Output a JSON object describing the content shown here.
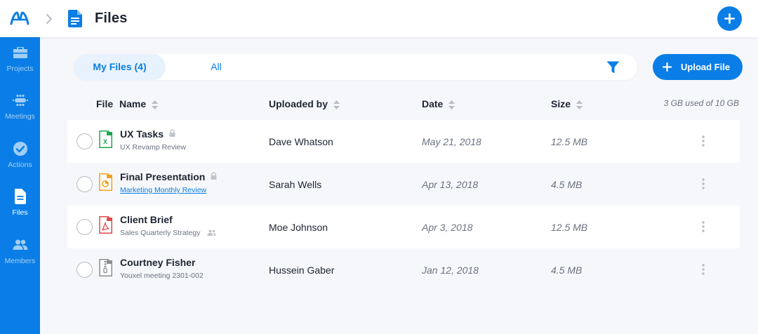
{
  "header": {
    "title": "Files",
    "logo_icon": "app-logo-icon",
    "breadcrumb_icon": "chevron-right-icon",
    "page_icon": "document-icon",
    "add_icon": "plus-icon"
  },
  "colors": {
    "accent": "#0a7ee6",
    "sidebar": "#0a7ee6",
    "text": "#1d2431",
    "muted": "#6b7280",
    "excel": "#1aa84f",
    "slides": "#f0a020",
    "pdf": "#e04a4a",
    "archive": "#8a8f96"
  },
  "sidebar": {
    "items": [
      {
        "label": "Projects",
        "icon": "briefcase-icon"
      },
      {
        "label": "Meetings",
        "icon": "meeting-table-icon"
      },
      {
        "label": "Actions",
        "icon": "check-circle-icon"
      },
      {
        "label": "Files",
        "icon": "document-icon",
        "active": true
      },
      {
        "label": "Members",
        "icon": "people-icon"
      }
    ]
  },
  "toolbar": {
    "tab_my_files": "My Files (4)",
    "tab_all": "All",
    "filter_icon": "filter-funnel-icon",
    "upload_label": "Upload File"
  },
  "table": {
    "columns": {
      "file": "File",
      "name": "Name",
      "uploaded_by": "Uploaded by",
      "date": "Date",
      "size": "Size"
    },
    "storage_note": "3 GB used of 10 GB",
    "rows": [
      {
        "name": "UX Tasks",
        "locked": true,
        "subtitle": "UX Revamp Review",
        "subtitle_link": false,
        "uploader": "Dave Whatson",
        "date": "May 21, 2018",
        "size": "12.5 MB",
        "type": "xls"
      },
      {
        "name": "Final Presentation",
        "locked": true,
        "subtitle": "Marketing Monthly Review",
        "subtitle_link": true,
        "uploader": "Sarah Wells",
        "date": "Apr 13, 2018",
        "size": "4.5 MB",
        "type": "ppt"
      },
      {
        "name": "Client Brief",
        "locked": false,
        "subtitle": "Sales Quarterly Strategy",
        "subtitle_link": false,
        "shared": true,
        "uploader": "Moe Johnson",
        "date": "Apr 3, 2018",
        "size": "12.5 MB",
        "type": "pdf"
      },
      {
        "name": "Courtney Fisher",
        "locked": false,
        "subtitle": "Youxel meeting 2301-002",
        "subtitle_link": false,
        "uploader": "Hussein Gaber",
        "date": "Jan 12, 2018",
        "size": "4.5 MB",
        "type": "zip"
      }
    ]
  }
}
